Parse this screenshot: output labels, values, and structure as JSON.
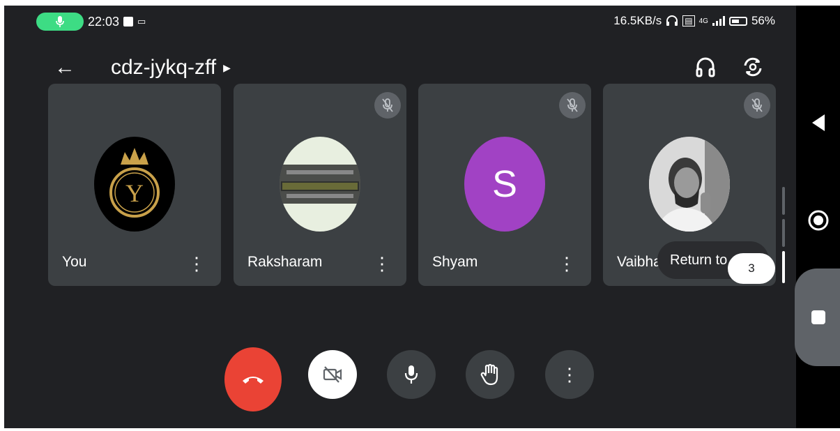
{
  "status_bar": {
    "time": "22:03",
    "net_speed": "16.5KB/s",
    "signal_label": "4G",
    "battery": "56%"
  },
  "header": {
    "meeting_code": "cdz-jykq-zff"
  },
  "participants": [
    {
      "name": "You",
      "avatar": "logo-y",
      "muted": false
    },
    {
      "name": "Raksharam",
      "avatar": "accounting-photo",
      "muted": true
    },
    {
      "name": "Shyam",
      "avatar": "letter",
      "letter": "S",
      "avatar_color": "#a142c4",
      "muted": true
    },
    {
      "name": "Vaibha",
      "avatar": "photo",
      "muted": true
    }
  ],
  "popup": {
    "return_label": "Return to",
    "count": "3"
  },
  "controls": {
    "end_color": "#ea4335",
    "camera_off": true
  },
  "colors": {
    "background": "#202124",
    "tile": "#3c4043",
    "accent_green": "#3ddc84"
  }
}
